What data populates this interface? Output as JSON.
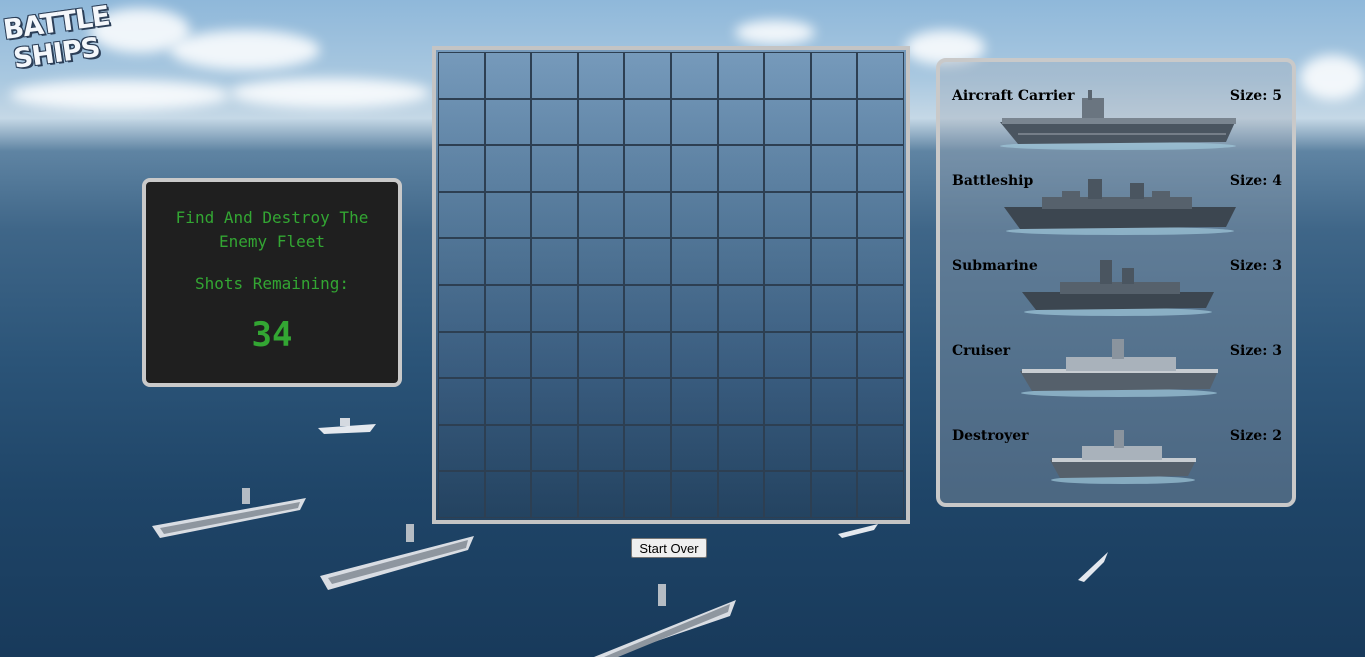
{
  "logo": {
    "line1": "BATTLE",
    "line2": "SHIPS"
  },
  "info": {
    "title": "Find And Destroy The Enemy Fleet",
    "shots_label": "Shots Remaining:",
    "shots_value": "34"
  },
  "board": {
    "rows": 10,
    "cols": 10
  },
  "controls": {
    "start_over": "Start Over"
  },
  "fleet": [
    {
      "name": "Aircraft Carrier",
      "size_label": "Size: 5",
      "icon": "aircraft-carrier-icon"
    },
    {
      "name": "Battleship",
      "size_label": "Size: 4",
      "icon": "battleship-icon"
    },
    {
      "name": "Submarine",
      "size_label": "Size: 3",
      "icon": "submarine-icon"
    },
    {
      "name": "Cruiser",
      "size_label": "Size: 3",
      "icon": "cruiser-icon"
    },
    {
      "name": "Destroyer",
      "size_label": "Size: 2",
      "icon": "destroyer-icon"
    }
  ],
  "colors": {
    "accent_green": "#33a633",
    "panel_dark": "#1f1f1f",
    "frame_gray": "#c9c9c9"
  }
}
